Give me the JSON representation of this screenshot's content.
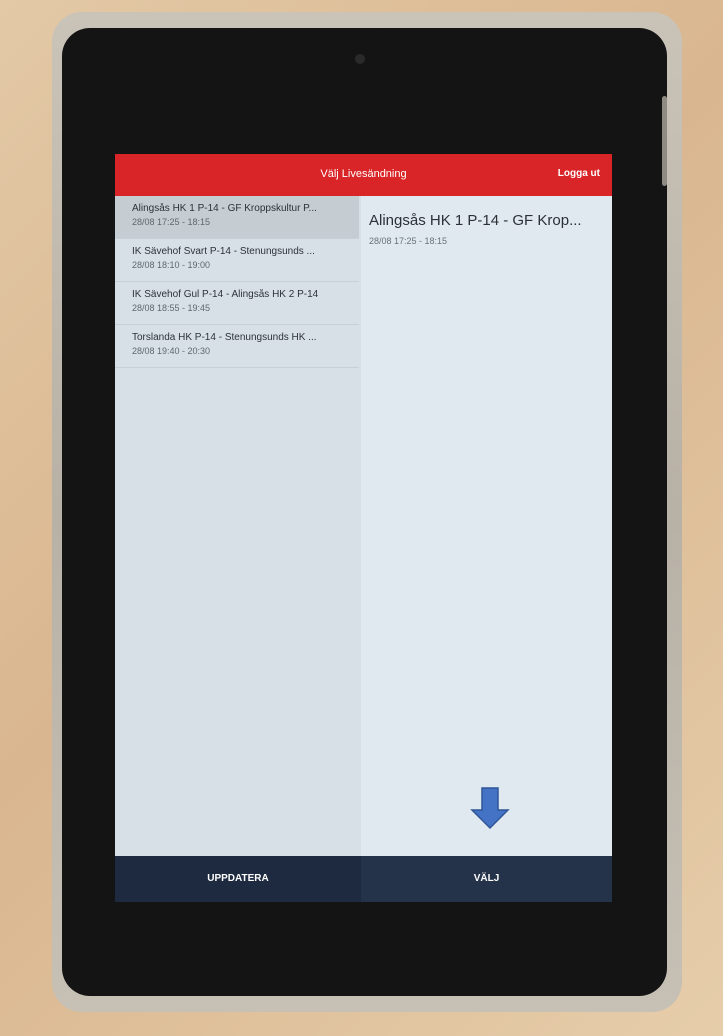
{
  "header": {
    "title": "Välj Livesändning",
    "logout_label": "Logga ut",
    "accent_color": "#d92528"
  },
  "list": {
    "items": [
      {
        "title": "Alingsås HK 1 P-14 - GF Kroppskultur P...",
        "time": "28/08 17:25 - 18:15",
        "selected": true
      },
      {
        "title": "IK Sävehof Svart P-14 - Stenungsunds ...",
        "time": "28/08 18:10 - 19:00",
        "selected": false
      },
      {
        "title": "IK Sävehof Gul P-14 - Alingsås HK 2 P-14",
        "time": "28/08 18:55 - 19:45",
        "selected": false
      },
      {
        "title": "Torslanda HK P-14 - Stenungsunds HK ...",
        "time": "28/08 19:40 - 20:30",
        "selected": false
      }
    ]
  },
  "detail": {
    "title": "Alingsås HK 1 P-14 - GF Krop...",
    "time": "28/08 17:25 - 18:15"
  },
  "footer": {
    "update_label": "UPPDATERA",
    "choose_label": "VÄLJ",
    "bar_color": "#1f2b40"
  },
  "annotation": {
    "icon": "down-arrow-icon",
    "color": "#4472c4"
  }
}
